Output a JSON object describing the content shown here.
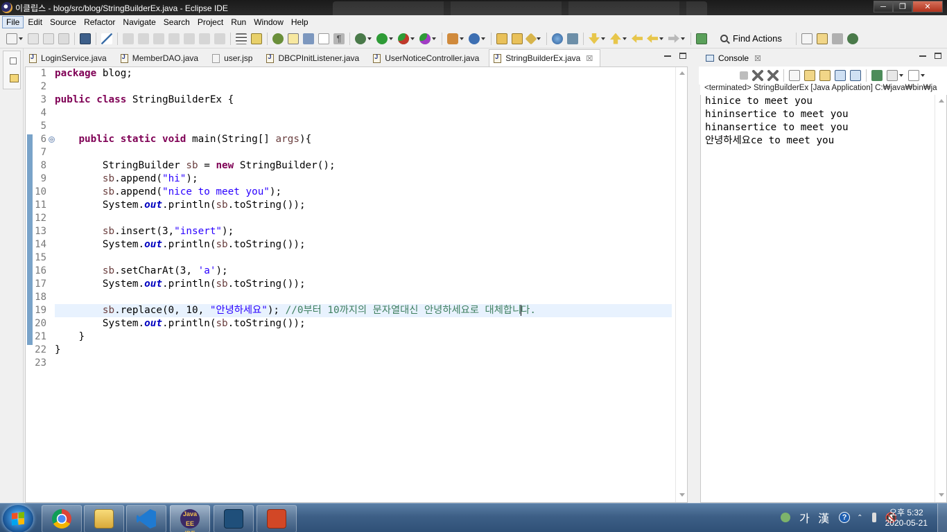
{
  "window": {
    "title": "이클립스 - blog/src/blog/StringBuilderEx.java - Eclipse IDE",
    "controls": {
      "minimize": "─",
      "maximize": "❐",
      "close": "✕"
    }
  },
  "menu": [
    "File",
    "Edit",
    "Source",
    "Refactor",
    "Navigate",
    "Search",
    "Project",
    "Run",
    "Window",
    "Help"
  ],
  "toolbar": {
    "find_actions": "Find Actions"
  },
  "editor": {
    "tabs": [
      {
        "label": "LoginService.java",
        "icon": "java-file-icon",
        "active": false
      },
      {
        "label": "MemberDAO.java",
        "icon": "java-file-icon",
        "active": false
      },
      {
        "label": "user.jsp",
        "icon": "jsp-file-icon",
        "active": false
      },
      {
        "label": "DBCPInitListener.java",
        "icon": "java-file-icon",
        "active": false
      },
      {
        "label": "UserNoticeController.java",
        "icon": "java-file-icon",
        "active": false
      },
      {
        "label": "StringBuilderEx.java",
        "icon": "java-file-icon",
        "active": true,
        "close": "☒"
      }
    ],
    "line_numbers": [
      "1",
      "2",
      "3",
      "4",
      "5",
      "6",
      "7",
      "8",
      "9",
      "10",
      "11",
      "12",
      "13",
      "14",
      "15",
      "16",
      "17",
      "18",
      "19",
      "20",
      "21",
      "22",
      "23"
    ],
    "fold_marker": "⊖",
    "current_line": 19,
    "tokens": {
      "package": "package",
      "blog": " blog;",
      "public": "public",
      "class": "class",
      "class_name": " StringBuilderEx {",
      "static": "static",
      "void": "void",
      "main_sig": " main(String[] ",
      "args": "args",
      "main_end": "){",
      "sb_type": "StringBuilder ",
      "sb": "sb",
      "eq_new_pre": " = ",
      "new": "new",
      "sb_ctor": " StringBuilder();",
      "append": ".append(",
      "str_hi": "\"hi\"",
      "str_nice": "\"nice to meet you\"",
      "close_stmt": ");",
      "system": "System.",
      "out": "out",
      "println_tostring": ".println(",
      "tostring": ".toString());",
      "insert": ".insert(3,",
      "str_insert": "\"insert\"",
      "setcharat": ".setCharAt(3, ",
      "char_a": "'a'",
      "replace": ".replace(0, 10, ",
      "str_annyeong": "\"안녕하세요\"",
      "comment": "//0부터 10까지의 문자열대신 안녕하세요로 대체합니",
      "comment_tail": "다.",
      "close_brace": "}"
    }
  },
  "console": {
    "tab_label": "Console",
    "tab_close": "☒",
    "process": "<terminated> StringBuilderEx [Java Application] C:₩java₩bin₩ja",
    "output": [
      "hinice to meet you",
      "hininsertice to meet you",
      "hinansertice to meet you",
      "안녕하세요ce to meet you"
    ]
  },
  "taskbar": {
    "apps": [
      "chrome",
      "file-explorer",
      "vscode",
      "javaee-ide",
      "mysql-workbench",
      "powerpoint"
    ],
    "javaee_label": "Java EE IDE",
    "ime": "가 漢",
    "help": "?",
    "time": "오후 5:32",
    "date": "2020-05-21"
  },
  "colors": {
    "keyword": "#7f0055",
    "string": "#2a00ff",
    "static_field": "#0000c0",
    "local_var": "#6a3e3e",
    "comment": "#3f7f5f",
    "current_line": "#e8f2fe"
  }
}
